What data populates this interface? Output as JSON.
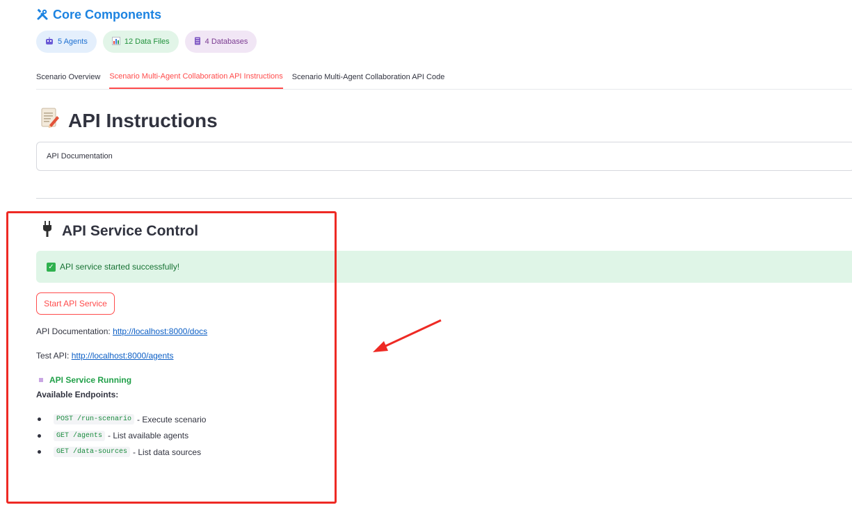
{
  "header": {
    "title": "Core Components",
    "title_icon": "tools-icon",
    "accent_color": "#1c83e1"
  },
  "badges": [
    {
      "label": "5 Agents",
      "icon": "robot-icon",
      "bg": "#e4effc",
      "fg": "#1c6fd1"
    },
    {
      "label": "12 Data Files",
      "icon": "bar-chart-icon",
      "bg": "#e2f5e8",
      "fg": "#21913c"
    },
    {
      "label": "4 Databases",
      "icon": "database-icon",
      "bg": "#f1e6f5",
      "fg": "#7a3b91"
    }
  ],
  "tabs": [
    {
      "label": "Scenario Overview",
      "active": false
    },
    {
      "label": "Scenario Multi-Agent Collaboration API Instructions",
      "active": true
    },
    {
      "label": "Scenario Multi-Agent Collaboration API Code",
      "active": false
    }
  ],
  "instructions": {
    "title": "API Instructions",
    "title_icon": "memo-icon",
    "expander_label": "API Documentation"
  },
  "service": {
    "title": "API Service Control",
    "title_icon": "plug-icon",
    "success_message": "API service started successfully!",
    "start_button_label": "Start API Service",
    "docs_prefix": "API Documentation: ",
    "docs_url": "http://localhost:8000/docs",
    "test_prefix": "Test API: ",
    "test_url": "http://localhost:8000/agents",
    "running_label": "API Service Running",
    "endpoints_label": "Available Endpoints:",
    "endpoints": [
      {
        "code": "POST /run-scenario",
        "desc": " - Execute scenario"
      },
      {
        "code": "GET /agents",
        "desc": " - List available agents"
      },
      {
        "code": "GET /data-sources",
        "desc": " - List data sources"
      }
    ]
  },
  "colors": {
    "primary_red": "#ff4b4b",
    "annotation_red": "#ee2a24",
    "success_bg": "#dff5e7",
    "success_text": "#177233",
    "link": "#0b5ec5"
  }
}
